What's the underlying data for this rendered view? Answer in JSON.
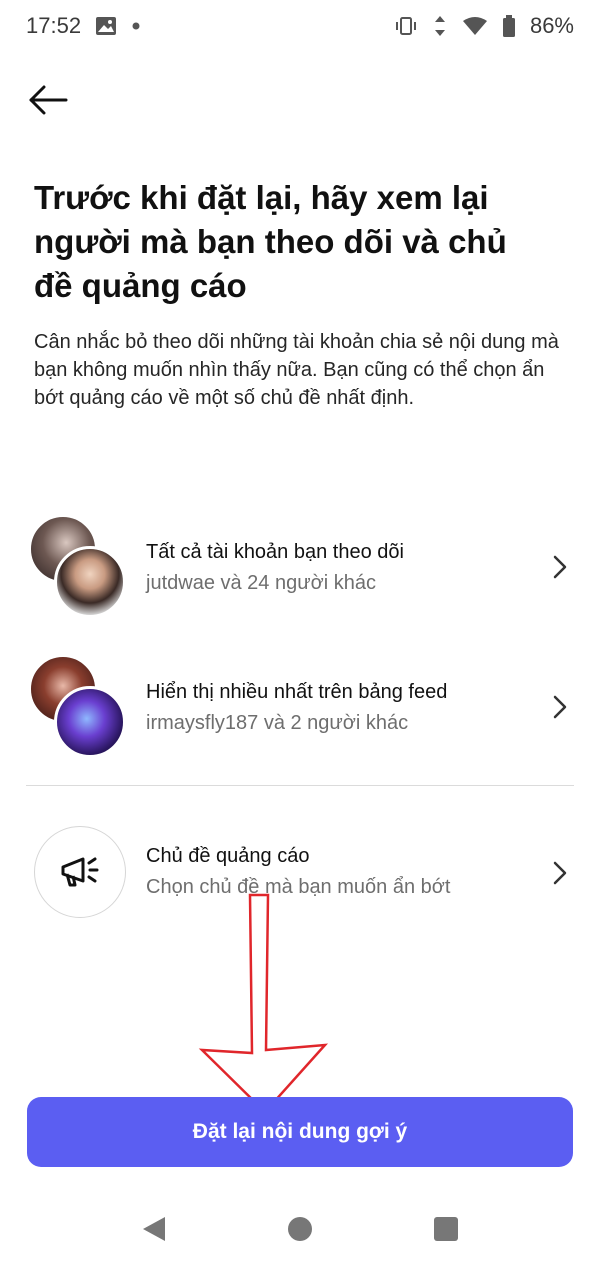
{
  "status_bar": {
    "time": "17:52",
    "battery": "86%",
    "icons": [
      "image-icon",
      "dot-icon",
      "vibrate-icon",
      "signal-icon",
      "wifi-icon",
      "battery-icon"
    ]
  },
  "header": {
    "back_icon": "arrow-left-icon"
  },
  "page": {
    "title": "Trước khi đặt lại, hãy xem lại người mà bạn theo dõi và chủ đề quảng cáo",
    "description": "Cân nhắc bỏ theo dõi những tài khoản chia sẻ nội dung mà bạn không muốn nhìn thấy nữa. Bạn cũng có thể chọn ẩn bớt quảng cáo về một số chủ đề nhất định."
  },
  "items": [
    {
      "title": "Tất cả tài khoản bạn theo dõi",
      "subtitle": "jutdwae và 24 người khác",
      "icon": "chevron-right-icon"
    },
    {
      "title": "Hiển thị nhiều nhất trên bảng feed",
      "subtitle": "irmaysfly187 và 2 người khác",
      "icon": "chevron-right-icon"
    },
    {
      "title": "Chủ đề quảng cáo",
      "subtitle": "Chọn chủ đề mà bạn muốn ẩn bớt",
      "icon": "megaphone-icon"
    }
  ],
  "primary_button": {
    "label": "Đặt lại nội dung gợi ý"
  },
  "colors": {
    "accent": "#5b5ef2",
    "annotation": "#e0262b"
  },
  "nav_bar": {
    "icons": [
      "back-triangle-icon",
      "home-circle-icon",
      "recents-square-icon"
    ]
  }
}
